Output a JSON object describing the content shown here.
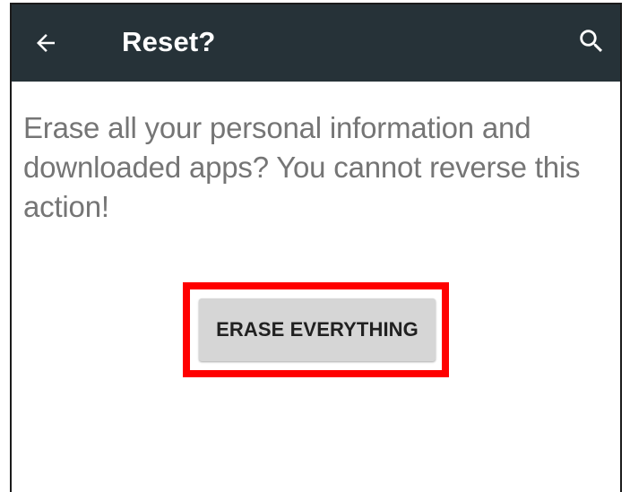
{
  "app_bar": {
    "title": "Reset?",
    "back_icon": "arrow-back-icon",
    "search_icon": "search-icon",
    "background_color": "#263238"
  },
  "content": {
    "message": "Erase all your personal information and downloaded apps? You cannot reverse this action!",
    "erase_button_label": "ERASE EVERYTHING",
    "highlight_color": "#ff0000"
  }
}
